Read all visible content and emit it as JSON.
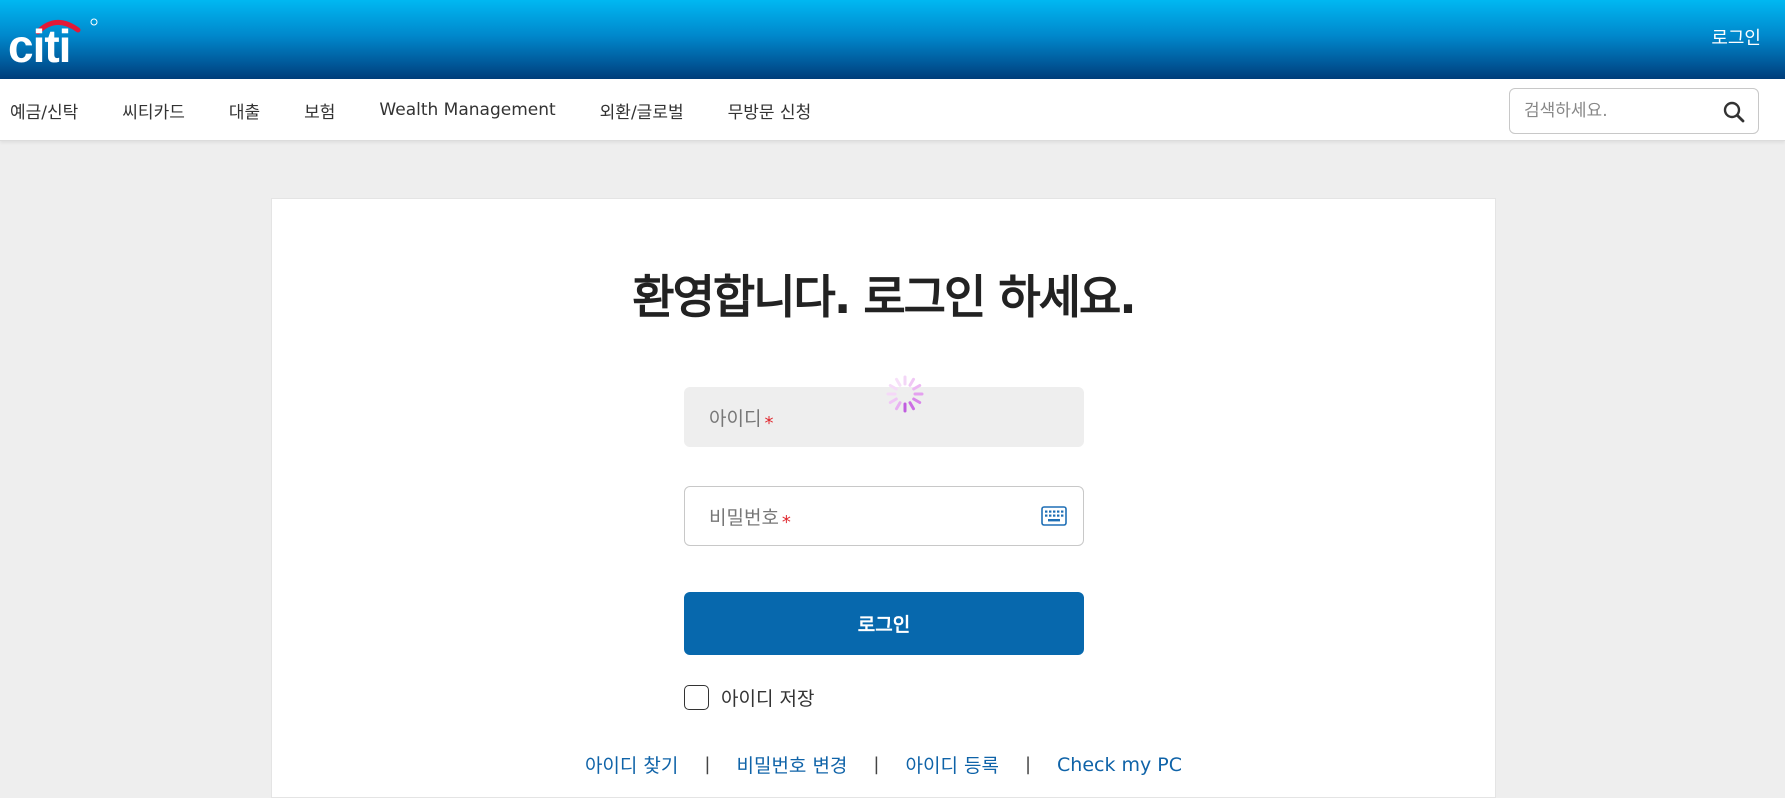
{
  "header": {
    "logo_text": "citi",
    "login_label": "로그인"
  },
  "nav": {
    "items": [
      {
        "label": "예금/신탁"
      },
      {
        "label": "씨티카드"
      },
      {
        "label": "대출"
      },
      {
        "label": "보험"
      },
      {
        "label": "Wealth Management"
      },
      {
        "label": "외환/글로벌"
      },
      {
        "label": "무방문 신청"
      }
    ],
    "search": {
      "placeholder": "검색하세요.",
      "value": "",
      "icon": "search-icon"
    }
  },
  "login_form": {
    "title": "환영합니다. 로그인 하세요.",
    "id_field": {
      "label": "아이디",
      "required_mark": "*",
      "value": ""
    },
    "password_field": {
      "label": "비밀번호",
      "required_mark": "*",
      "value": "",
      "icon": "keyboard-icon"
    },
    "login_button": "로그인",
    "save_id": {
      "label": "아이디 저장",
      "checked": false
    },
    "links": [
      {
        "label": "아이디 찾기"
      },
      {
        "label": "비밀번호 변경"
      },
      {
        "label": "아이디 등록"
      },
      {
        "label": "Check my PC"
      }
    ],
    "link_separator": "|"
  },
  "colors": {
    "header_top": "#00b8f2",
    "header_bottom": "#003d7a",
    "primary_button": "#0768ad",
    "link": "#0f63a8",
    "required": "#e0282f",
    "logo_arc": "#e31837"
  }
}
